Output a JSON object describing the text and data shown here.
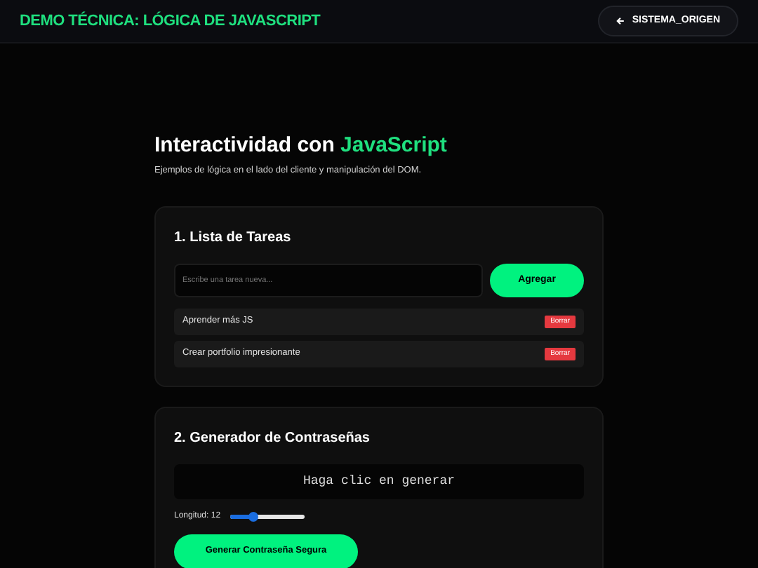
{
  "header": {
    "title": "DEMO TÉCNICA: LÓGICA DE JAVASCRIPT",
    "back_button": "SISTEMA_ORIGEN"
  },
  "hero": {
    "title": "Interactividad con ",
    "title_highlight": "JavaScript",
    "subtitle": "Ejemplos de lógica en el lado del cliente y manipulación del DOM."
  },
  "todo": {
    "title": "1. Lista de Tareas",
    "input": {
      "placeholder": "Escribe una tarea nueva..."
    },
    "add_button": "Agregar",
    "tasks": [
      {
        "text": "Aprender más JS",
        "delete_button": "Borrar"
      },
      {
        "text": "Crear portfolio impresionante",
        "delete_button": "Borrar"
      }
    ]
  },
  "password": {
    "title": "2. Generador de Contraseñas",
    "output": "Haga clic en generar",
    "length_label": "Longitud: 12",
    "slider": {
      "level": 0.32
    },
    "generate_button": "Generar Contraseña Segura"
  }
}
